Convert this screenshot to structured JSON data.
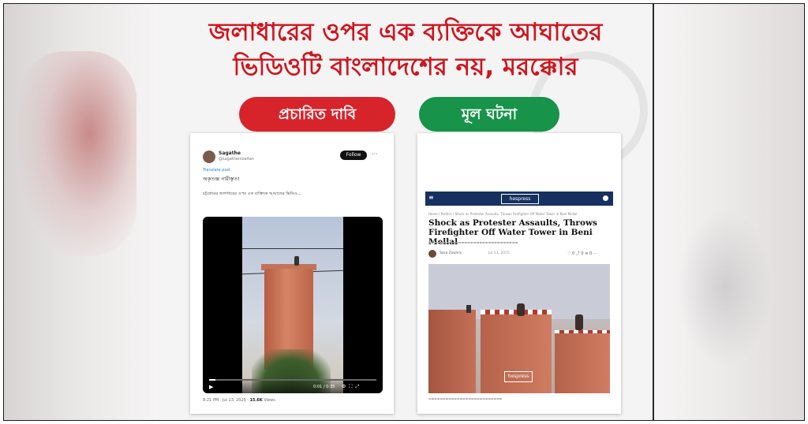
{
  "headline": {
    "line1": "জলাধারের ওপর এক ব্যক্তিকে আঘাতের",
    "line2": "ভিডিওটি বাংলাদেশের নয়, মরক্কোর"
  },
  "labels": {
    "claim": "প্রচারিত দাবি",
    "fact": "মূল ঘটনা"
  },
  "tweet": {
    "name": "Sagathe",
    "handle": "@sagathenizaltan",
    "follow": "Follow",
    "more": "···",
    "translate": "Translate post",
    "line1": "অকৃতজ্ঞ নারীস্তৃত!",
    "body": "চট্টগ্রামের জলাধারের ওপর এক ব্যক্তিকে আঘাতের ভিডিও...",
    "time": "0:01 / 0:35",
    "meta_time": "8:21 PM · Jul 13, 2025 ·",
    "meta_views": "15.6K",
    "meta_views_label": "Views",
    "progress": 0.04
  },
  "article": {
    "menu": "≡",
    "logo": "hespress",
    "crumb": "Home / Politics / Shock as Protester Assaults, Throws Firefighter Off Water Tower in Beni Mellal",
    "title": "Shock as Protester Assaults, Throws Firefighter Off Water Tower in Beni Mellal",
    "author": "Sara Zouhra",
    "date": "Jul 13, 2025",
    "share": "♡ 0  ⤴ 0  ≡ 0  ⋯",
    "watermark": "hespress"
  }
}
